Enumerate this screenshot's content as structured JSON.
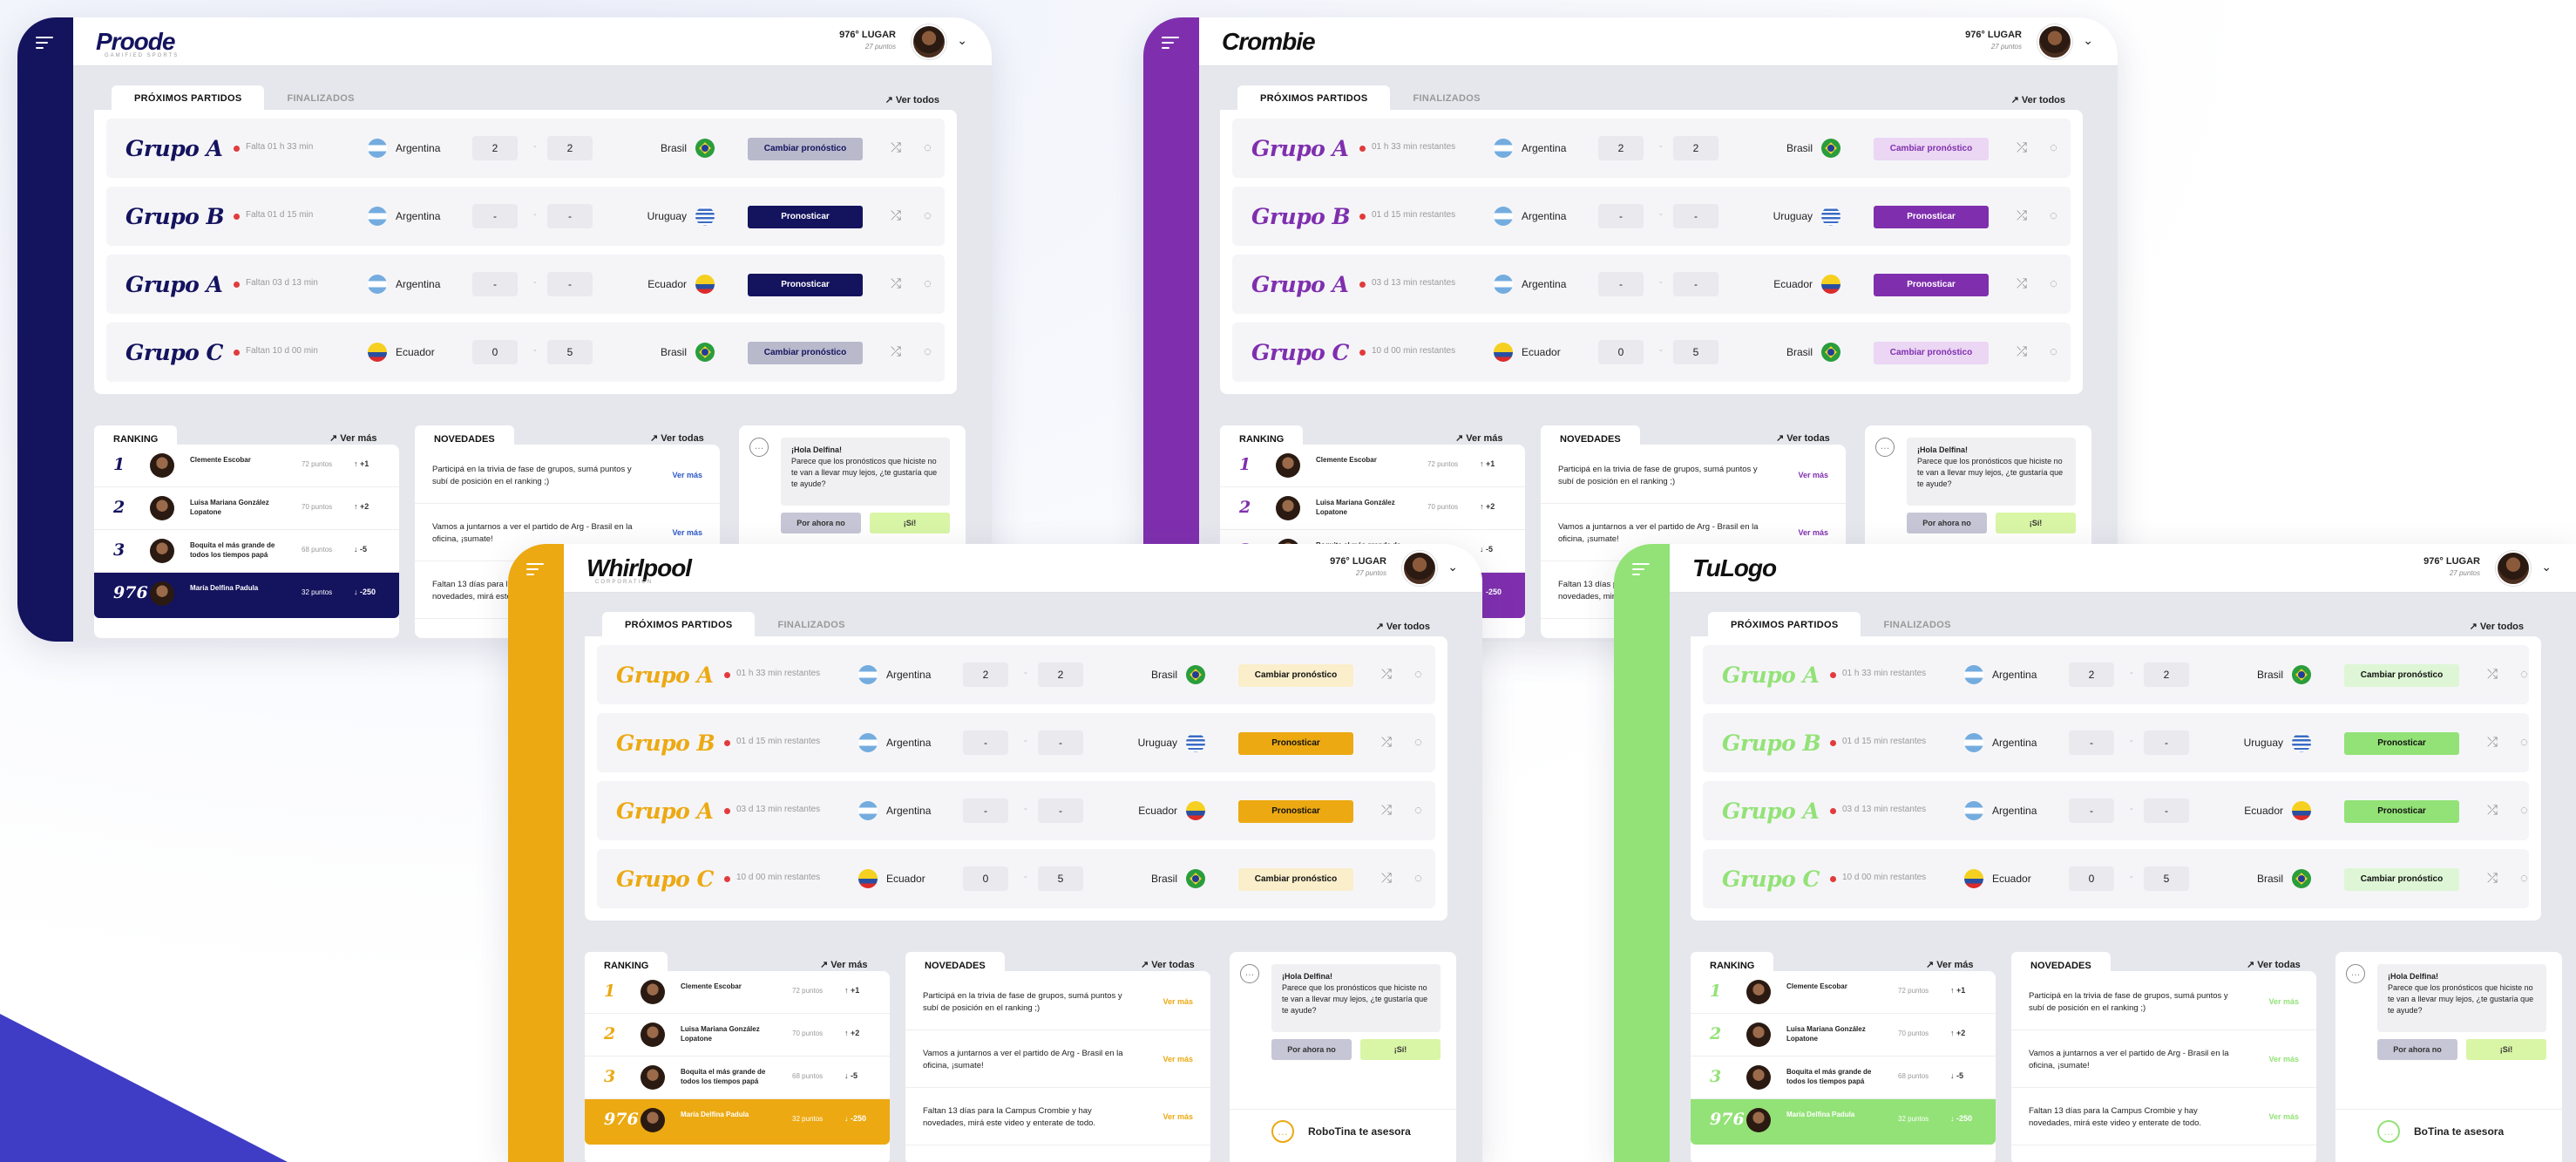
{
  "themes": [
    {
      "id": "proode",
      "logo": "Proode",
      "logo_sub": "GAMIFIED SPORTS",
      "side": "#14135e",
      "accent": "#14135e",
      "grupo_color": "#14135e",
      "btn_primary_bg": "#14135e",
      "btn_primary_fg": "#ffffff",
      "btn_secondary_bg": "#b9b9cc",
      "btn_secondary_fg": "#14135e",
      "link": "#2b58c7",
      "me_bg": "#14135e",
      "bot_no_bg": "#c6c6d6",
      "bot_foot_color": "#888888"
    },
    {
      "id": "crombie",
      "logo": "Crombie",
      "logo_sub": "",
      "side": "#7f2fae",
      "accent": "#7f2fae",
      "grupo_color": "#7f2fae",
      "btn_primary_bg": "#7f2fae",
      "btn_primary_fg": "#ffffff",
      "btn_secondary_bg": "#ebd6f3",
      "btn_secondary_fg": "#7f2fae",
      "link": "#7f2fae",
      "me_bg": "#7f2fae",
      "bot_no_bg": "#c6c6d6",
      "bot_foot_color": "#888888"
    },
    {
      "id": "whirlpool",
      "logo": "Whirlpool",
      "logo_sub": "CORPORATION",
      "side": "#eca912",
      "accent": "#eca912",
      "grupo_color": "#eca912",
      "btn_primary_bg": "#eca912",
      "btn_primary_fg": "#111111",
      "btn_secondary_bg": "#faeecb",
      "btn_secondary_fg": "#111111",
      "link": "#eca912",
      "me_bg": "#eca912",
      "bot_no_bg": "#c6c6d6",
      "bot_foot_color": "#eca912"
    },
    {
      "id": "tulogo",
      "logo": "TuLogo",
      "logo_sub": "",
      "side": "#93e277",
      "accent": "#93e277",
      "grupo_color": "#93e277",
      "btn_primary_bg": "#93e277",
      "btn_primary_fg": "#111111",
      "btn_secondary_bg": "#def6d5",
      "btn_secondary_fg": "#111111",
      "link": "#93e277",
      "me_bg": "#93e277",
      "bot_no_bg": "#c6c6d6",
      "bot_foot_color": "#93e277"
    }
  ],
  "header": {
    "lugar": "976° LUGAR",
    "puntos": "27 puntos"
  },
  "tabs": {
    "proximos": "PRÓXIMOS PARTIDOS",
    "finalizados": "FINALIZADOS",
    "ver_todos": "Ver todos"
  },
  "matches_proode": [
    {
      "grupo": "Grupo A",
      "time": "Falta 01 h 33 min",
      "home": "Argentina",
      "home_flag": "arg",
      "score_h": "2",
      "score_a": "2",
      "away": "Brasil",
      "away_flag": "bra",
      "action": "Cambiar pronóstico",
      "primary": false
    },
    {
      "grupo": "Grupo B",
      "time": "Falta 01 d 15 min",
      "home": "Argentina",
      "home_flag": "arg",
      "score_h": "-",
      "score_a": "-",
      "away": "Uruguay",
      "away_flag": "uru",
      "action": "Pronosticar",
      "primary": true
    },
    {
      "grupo": "Grupo A",
      "time": "Faltan 03 d 13 min",
      "home": "Argentina",
      "home_flag": "arg",
      "score_h": "-",
      "score_a": "-",
      "away": "Ecuador",
      "away_flag": "ecu",
      "action": "Pronosticar",
      "primary": true
    },
    {
      "grupo": "Grupo C",
      "time": "Faltan 10 d 00 min",
      "home": "Ecuador",
      "home_flag": "ecu",
      "score_h": "0",
      "score_a": "5",
      "away": "Brasil",
      "away_flag": "bra",
      "action": "Cambiar pronóstico",
      "primary": false
    }
  ],
  "matches_other": [
    {
      "grupo": "Grupo A",
      "time": "01 h 33 min restantes",
      "home": "Argentina",
      "home_flag": "arg",
      "score_h": "2",
      "score_a": "2",
      "away": "Brasil",
      "away_flag": "bra",
      "action": "Cambiar pronóstico",
      "primary": false
    },
    {
      "grupo": "Grupo B",
      "time": "01 d 15 min restantes",
      "home": "Argentina",
      "home_flag": "arg",
      "score_h": "-",
      "score_a": "-",
      "away": "Uruguay",
      "away_flag": "uru",
      "action": "Pronosticar",
      "primary": true
    },
    {
      "grupo": "Grupo A",
      "time": "03 d 13 min restantes",
      "home": "Argentina",
      "home_flag": "arg",
      "score_h": "-",
      "score_a": "-",
      "away": "Ecuador",
      "away_flag": "ecu",
      "action": "Pronosticar",
      "primary": true
    },
    {
      "grupo": "Grupo C",
      "time": "10 d 00 min restantes",
      "home": "Ecuador",
      "home_flag": "ecu",
      "score_h": "0",
      "score_a": "5",
      "away": "Brasil",
      "away_flag": "bra",
      "action": "Cambiar pronóstico",
      "primary": false
    }
  ],
  "ranking": {
    "title": "RANKING",
    "link": "Ver más",
    "rows": [
      {
        "pos": "1",
        "name": "Clemente Escobar",
        "pts": "72 puntos",
        "chg": "↑ +1"
      },
      {
        "pos": "2",
        "name": "Luisa Mariana González Lopatone",
        "pts": "70 puntos",
        "chg": "↑ +2"
      },
      {
        "pos": "3",
        "name": "Boquita el más grande de todos los tiempos papá",
        "pts": "68 puntos",
        "chg": "↓ -5"
      },
      {
        "pos": "976",
        "name": "María Delfina Padula",
        "pts": "32 puntos",
        "chg": "↓ -250"
      }
    ]
  },
  "novedades": {
    "title": "NOVEDADES",
    "link": "Ver todas",
    "more": "Ver más",
    "items": [
      "Participá en la trivia de fase de grupos, sumá puntos y subí de posición en el ranking ;)",
      "Vamos a juntarnos a ver el partido de Arg - Brasil en la oficina, ¡sumate!",
      "Faltan 13 días para la Campus Crombie y hay novedades, mirá este video y enterate de todo."
    ]
  },
  "bot": {
    "greeting": "¡Hola Delfina!",
    "message": "Parece que los pronósticos que hiciste no te van a llevar muy lejos, ¿te gustaría que te ayude?",
    "no": "Por ahora no",
    "si": "¡Sí!",
    "footer": "RoboTina te asesora",
    "footer_alt": "BoTina te asesora"
  }
}
